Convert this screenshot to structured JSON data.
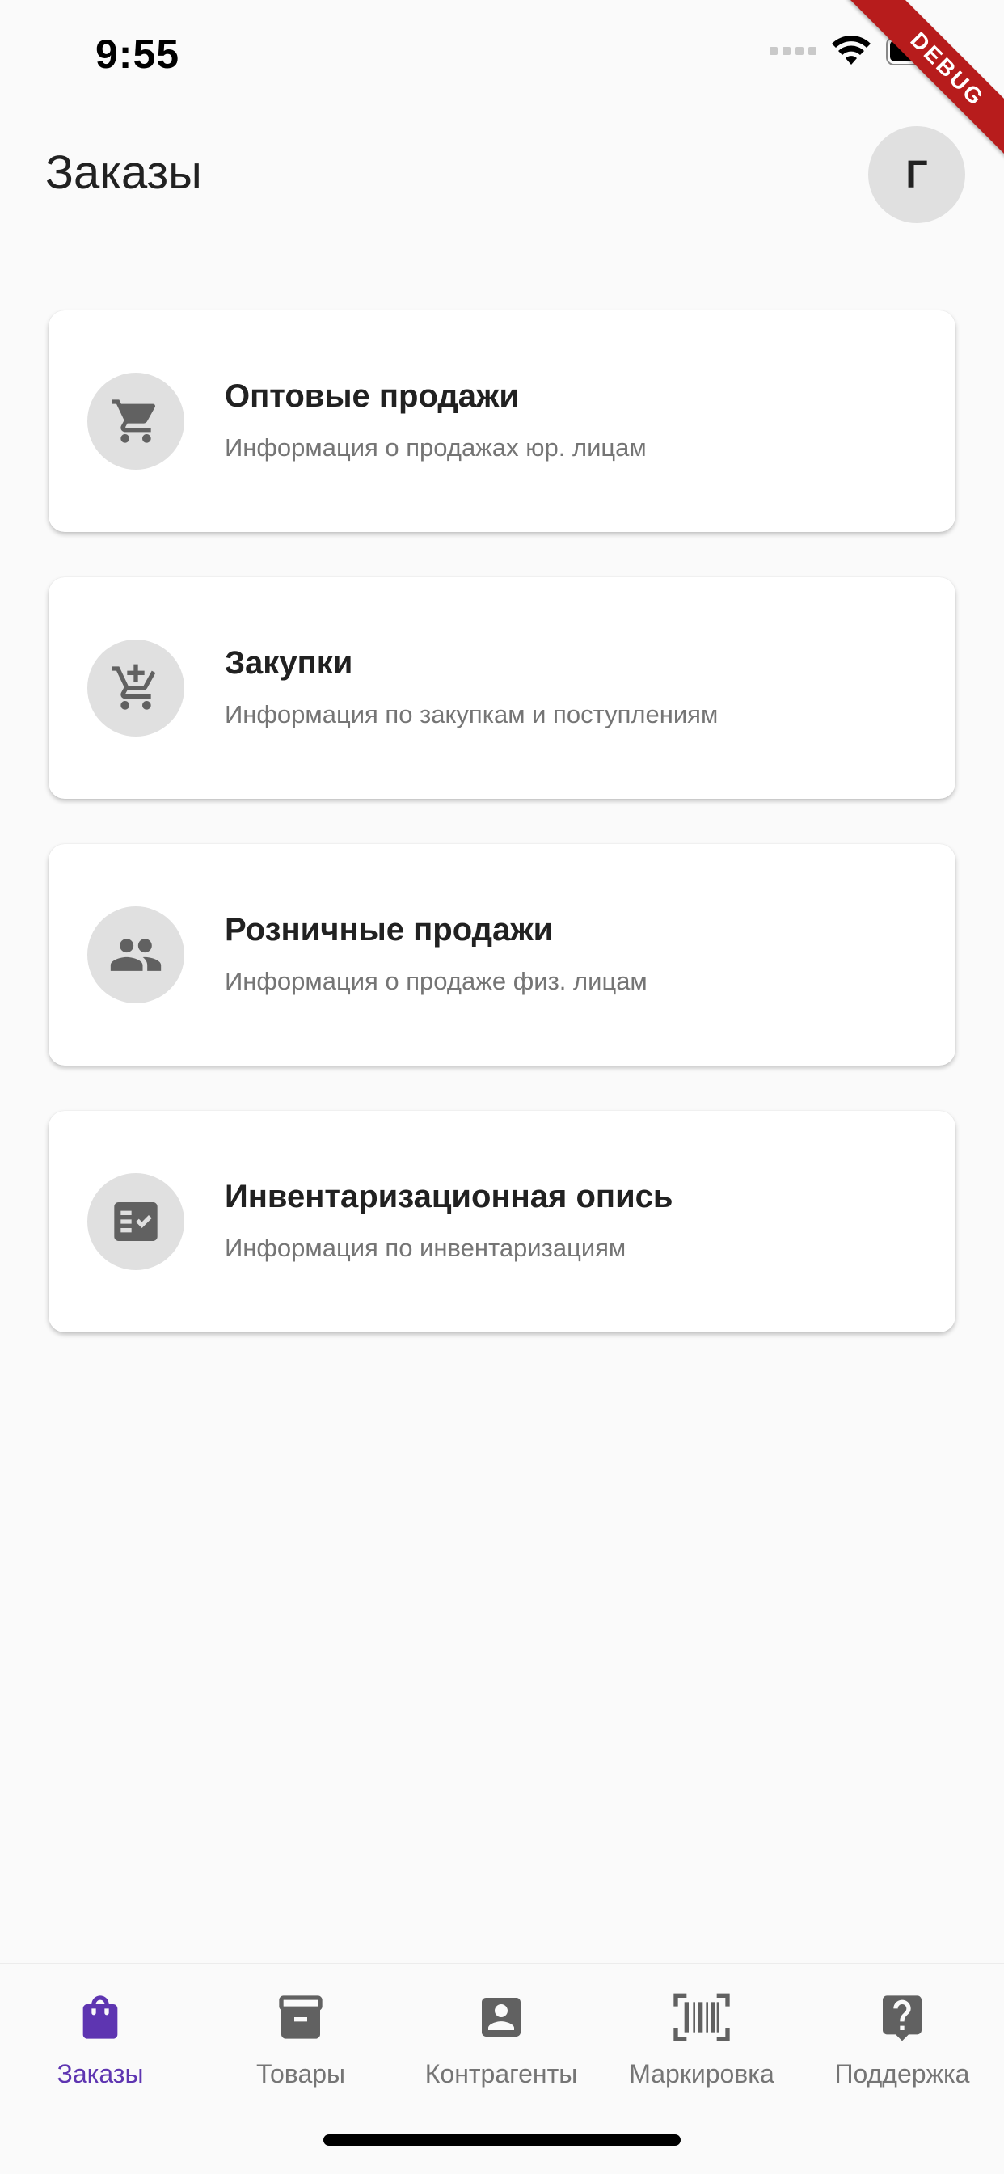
{
  "status_bar": {
    "time": "9:55"
  },
  "debug_banner": "DEBUG",
  "header": {
    "title": "Заказы",
    "avatar_initial": "Г"
  },
  "cards": [
    {
      "title": "Оптовые продажи",
      "subtitle": "Информация о продажах юр. лицам",
      "icon": "shopping-cart-icon"
    },
    {
      "title": "Закупки",
      "subtitle": "Информация по закупкам и поступлениям",
      "icon": "add-shopping-cart-icon"
    },
    {
      "title": "Розничные продажи",
      "subtitle": "Информация о продаже физ. лицам",
      "icon": "people-icon"
    },
    {
      "title": "Инвентаризационная опись",
      "subtitle": "Информация по инвентаризациям",
      "icon": "fact-check-icon"
    }
  ],
  "bottom_nav": {
    "active_index": 0,
    "items": [
      {
        "label": "Заказы",
        "icon": "shopping-bag-icon"
      },
      {
        "label": "Товары",
        "icon": "inventory-box-icon"
      },
      {
        "label": "Контрагенты",
        "icon": "account-box-icon"
      },
      {
        "label": "Маркировка",
        "icon": "barcode-scanner-icon"
      },
      {
        "label": "Поддержка",
        "icon": "help-bubble-icon"
      }
    ]
  },
  "colors": {
    "background": "#fafafa",
    "card": "#ffffff",
    "icon_circle": "#e0e0e0",
    "icon": "#616161",
    "active": "#5e35b1",
    "inactive": "#757575",
    "debug_ribbon": "#b71c1c"
  }
}
